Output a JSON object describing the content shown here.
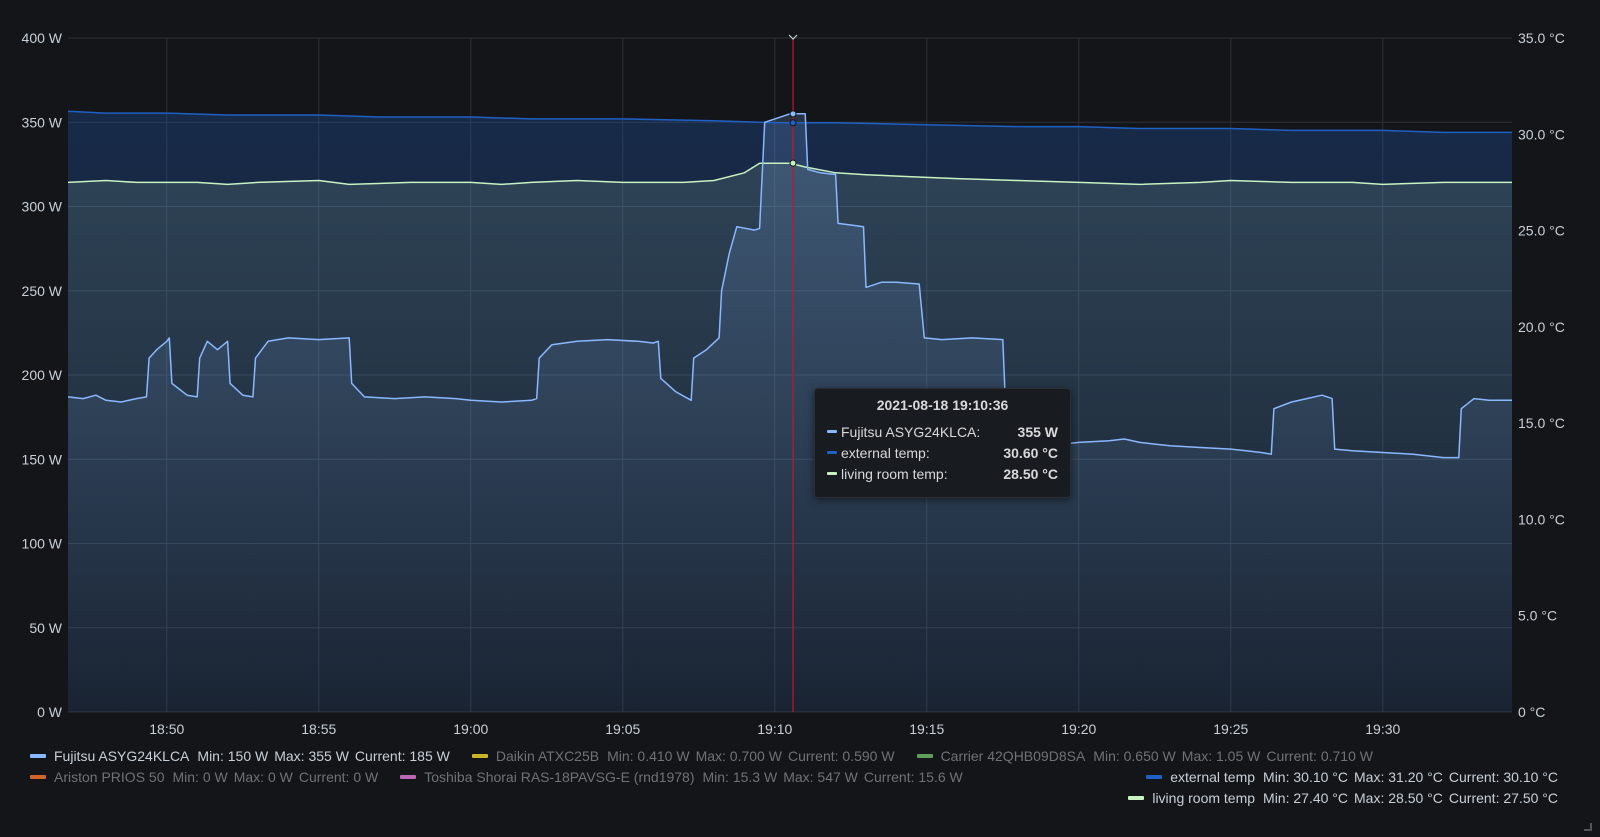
{
  "panel": {
    "tooltip": {
      "time": "2021-08-18 19:10:36",
      "rows": [
        {
          "name": "Fujitsu ASYG24KLCA:",
          "value": "355 W",
          "color": "#8ab8ff"
        },
        {
          "name": "external temp:",
          "value": "30.60 °C",
          "color": "#1f60c4"
        },
        {
          "name": "living room temp:",
          "value": "28.50 °C",
          "color": "#c8f2c2"
        }
      ]
    },
    "legend": [
      {
        "name": "Fujitsu ASYG24KLCA",
        "min": "Min: 150 W",
        "max": "Max: 355 W",
        "current": "Current: 185 W",
        "color": "#8ab8ff",
        "hidden": false
      },
      {
        "name": "Daikin ATXC25B",
        "min": "Min: 0.410 W",
        "max": "Max: 0.700 W",
        "current": "Current: 0.590 W",
        "color": "#fade2a",
        "hidden": true
      },
      {
        "name": "Carrier 42QHB09D8SA",
        "min": "Min: 0.650 W",
        "max": "Max: 1.05 W",
        "current": "Current: 0.710 W",
        "color": "#73bf69",
        "hidden": true
      },
      {
        "name": "Ariston PRIOS 50",
        "min": "Min: 0 W",
        "max": "Max: 0 W",
        "current": "Current: 0 W",
        "color": "#ff7830",
        "hidden": true
      },
      {
        "name": "Toshiba Shorai RAS-18PAVSG-E (rnd1978)",
        "min": "Min: 15.3 W",
        "max": "Max: 547 W",
        "current": "Current: 15.6 W",
        "color": "#e67adf",
        "hidden": true
      },
      {
        "name": "external temp",
        "min": "Min: 30.10 °C",
        "max": "Max: 31.20 °C",
        "current": "Current: 30.10 °C",
        "color": "#1f60c4",
        "hidden": false
      },
      {
        "name": "living room temp",
        "min": "Min: 27.40 °C",
        "max": "Max: 28.50 °C",
        "current": "Current: 27.50 °C",
        "color": "#c8f2c2",
        "hidden": false
      }
    ]
  },
  "chart_data": {
    "type": "line",
    "x_ticks": [
      "18:50",
      "18:55",
      "19:00",
      "19:05",
      "19:10",
      "19:15",
      "19:20",
      "19:25",
      "19:30"
    ],
    "x_range": [
      "18:46:45",
      "19:34:15"
    ],
    "y_left": {
      "ticks": [
        "0 W",
        "50 W",
        "100 W",
        "150 W",
        "200 W",
        "250 W",
        "300 W",
        "350 W",
        "400 W"
      ],
      "range": [
        0,
        400
      ],
      "unit": "W"
    },
    "y_right": {
      "ticks": [
        "0 °C",
        "5.0 °C",
        "10.0 °C",
        "15.0 °C",
        "20.0 °C",
        "25.0 °C",
        "30.0 °C",
        "35.0 °C"
      ],
      "range": [
        0,
        35
      ],
      "unit": "°C"
    },
    "grid": true,
    "cursor_time": "19:10:36",
    "series": [
      {
        "name": "Fujitsu ASYG24KLCA",
        "axis": "left",
        "color": "#8ab8ff",
        "points": [
          [
            "18:46:45",
            187
          ],
          [
            "18:47:15",
            186
          ],
          [
            "18:47:40",
            188
          ],
          [
            "18:48:00",
            185
          ],
          [
            "18:48:30",
            184
          ],
          [
            "18:49:00",
            186
          ],
          [
            "18:49:20",
            187
          ],
          [
            "18:49:25",
            210
          ],
          [
            "18:49:40",
            215
          ],
          [
            "18:50:00",
            220
          ],
          [
            "18:50:05",
            222
          ],
          [
            "18:50:10",
            195
          ],
          [
            "18:50:40",
            188
          ],
          [
            "18:51:00",
            187
          ],
          [
            "18:51:05",
            210
          ],
          [
            "18:51:20",
            220
          ],
          [
            "18:51:40",
            215
          ],
          [
            "18:52:00",
            220
          ],
          [
            "18:52:05",
            195
          ],
          [
            "18:52:30",
            188
          ],
          [
            "18:52:50",
            187
          ],
          [
            "18:52:55",
            210
          ],
          [
            "18:53:20",
            220
          ],
          [
            "18:54:00",
            222
          ],
          [
            "18:55:00",
            221
          ],
          [
            "18:56:00",
            222
          ],
          [
            "18:56:05",
            195
          ],
          [
            "18:56:30",
            187
          ],
          [
            "18:57:30",
            186
          ],
          [
            "18:58:30",
            187
          ],
          [
            "18:59:30",
            186
          ],
          [
            "19:00:00",
            185
          ],
          [
            "19:01:00",
            184
          ],
          [
            "19:02:00",
            185
          ],
          [
            "19:02:10",
            186
          ],
          [
            "19:02:15",
            210
          ],
          [
            "19:02:40",
            218
          ],
          [
            "19:03:30",
            220
          ],
          [
            "19:04:30",
            221
          ],
          [
            "19:05:30",
            220
          ],
          [
            "19:06:00",
            219
          ],
          [
            "19:06:10",
            220
          ],
          [
            "19:06:15",
            198
          ],
          [
            "19:06:45",
            190
          ],
          [
            "19:07:15",
            185
          ],
          [
            "19:07:20",
            210
          ],
          [
            "19:07:45",
            215
          ],
          [
            "19:08:10",
            222
          ],
          [
            "19:08:15",
            250
          ],
          [
            "19:08:30",
            272
          ],
          [
            "19:08:45",
            288
          ],
          [
            "19:09:20",
            286
          ],
          [
            "19:09:30",
            287
          ],
          [
            "19:09:40",
            350
          ],
          [
            "19:10:00",
            352
          ],
          [
            "19:10:30",
            355
          ],
          [
            "19:11:00",
            355
          ],
          [
            "19:11:05",
            322
          ],
          [
            "19:11:30",
            320
          ],
          [
            "19:12:00",
            319
          ],
          [
            "19:12:05",
            290
          ],
          [
            "19:12:30",
            289
          ],
          [
            "19:12:55",
            288
          ],
          [
            "19:13:00",
            252
          ],
          [
            "19:13:30",
            255
          ],
          [
            "19:14:00",
            255
          ],
          [
            "19:14:45",
            254
          ],
          [
            "19:14:55",
            222
          ],
          [
            "19:15:30",
            221
          ],
          [
            "19:16:30",
            222
          ],
          [
            "19:17:30",
            221
          ],
          [
            "19:17:35",
            185
          ],
          [
            "19:17:40",
            158
          ],
          [
            "19:18:00",
            156
          ],
          [
            "19:18:30",
            157
          ],
          [
            "19:19:00",
            158
          ],
          [
            "19:20:00",
            160
          ],
          [
            "19:21:00",
            161
          ],
          [
            "19:21:30",
            162
          ],
          [
            "19:22:00",
            160
          ],
          [
            "19:22:30",
            159
          ],
          [
            "19:23:00",
            158
          ],
          [
            "19:24:00",
            157
          ],
          [
            "19:25:00",
            156
          ],
          [
            "19:25:30",
            155
          ],
          [
            "19:26:00",
            154
          ],
          [
            "19:26:20",
            153
          ],
          [
            "19:26:25",
            180
          ],
          [
            "19:27:00",
            184
          ],
          [
            "19:27:30",
            186
          ],
          [
            "19:28:00",
            188
          ],
          [
            "19:28:20",
            186
          ],
          [
            "19:28:25",
            156
          ],
          [
            "19:29:00",
            155
          ],
          [
            "19:30:00",
            154
          ],
          [
            "19:31:00",
            153
          ],
          [
            "19:32:00",
            151
          ],
          [
            "19:32:30",
            151
          ],
          [
            "19:32:35",
            180
          ],
          [
            "19:33:00",
            186
          ],
          [
            "19:33:30",
            185
          ],
          [
            "19:34:15",
            185
          ]
        ]
      },
      {
        "name": "external temp",
        "axis": "right",
        "color": "#1f60c4",
        "points": [
          [
            "18:46:45",
            31.2
          ],
          [
            "18:48:00",
            31.1
          ],
          [
            "18:49:00",
            31.1
          ],
          [
            "18:50:00",
            31.1
          ],
          [
            "18:52:00",
            31.0
          ],
          [
            "18:55:00",
            31.0
          ],
          [
            "18:57:00",
            30.9
          ],
          [
            "19:00:00",
            30.9
          ],
          [
            "19:02:00",
            30.8
          ],
          [
            "19:05:00",
            30.8
          ],
          [
            "19:08:00",
            30.7
          ],
          [
            "19:10:00",
            30.6
          ],
          [
            "19:12:00",
            30.6
          ],
          [
            "19:15:00",
            30.5
          ],
          [
            "19:18:00",
            30.4
          ],
          [
            "19:20:00",
            30.4
          ],
          [
            "19:22:00",
            30.3
          ],
          [
            "19:25:00",
            30.3
          ],
          [
            "19:27:00",
            30.2
          ],
          [
            "19:30:00",
            30.2
          ],
          [
            "19:32:00",
            30.1
          ],
          [
            "19:34:15",
            30.1
          ]
        ]
      },
      {
        "name": "living room temp",
        "axis": "right",
        "color": "#c8f2c2",
        "points": [
          [
            "18:46:45",
            27.5
          ],
          [
            "18:48:00",
            27.6
          ],
          [
            "18:49:00",
            27.5
          ],
          [
            "18:51:00",
            27.5
          ],
          [
            "18:52:00",
            27.4
          ],
          [
            "18:53:00",
            27.5
          ],
          [
            "18:55:00",
            27.6
          ],
          [
            "18:56:00",
            27.4
          ],
          [
            "18:58:00",
            27.5
          ],
          [
            "19:00:00",
            27.5
          ],
          [
            "19:01:00",
            27.4
          ],
          [
            "19:02:00",
            27.5
          ],
          [
            "19:03:30",
            27.6
          ],
          [
            "19:05:00",
            27.5
          ],
          [
            "19:07:00",
            27.5
          ],
          [
            "19:08:00",
            27.6
          ],
          [
            "19:09:00",
            28.0
          ],
          [
            "19:09:30",
            28.5
          ],
          [
            "19:10:30",
            28.5
          ],
          [
            "19:11:00",
            28.3
          ],
          [
            "19:12:00",
            28.0
          ],
          [
            "19:13:00",
            27.9
          ],
          [
            "19:14:30",
            27.8
          ],
          [
            "19:16:00",
            27.7
          ],
          [
            "19:18:00",
            27.6
          ],
          [
            "19:20:00",
            27.5
          ],
          [
            "19:22:00",
            27.4
          ],
          [
            "19:24:00",
            27.5
          ],
          [
            "19:25:00",
            27.6
          ],
          [
            "19:27:00",
            27.5
          ],
          [
            "19:29:00",
            27.5
          ],
          [
            "19:30:00",
            27.4
          ],
          [
            "19:32:00",
            27.5
          ],
          [
            "19:34:15",
            27.5
          ]
        ]
      }
    ]
  }
}
